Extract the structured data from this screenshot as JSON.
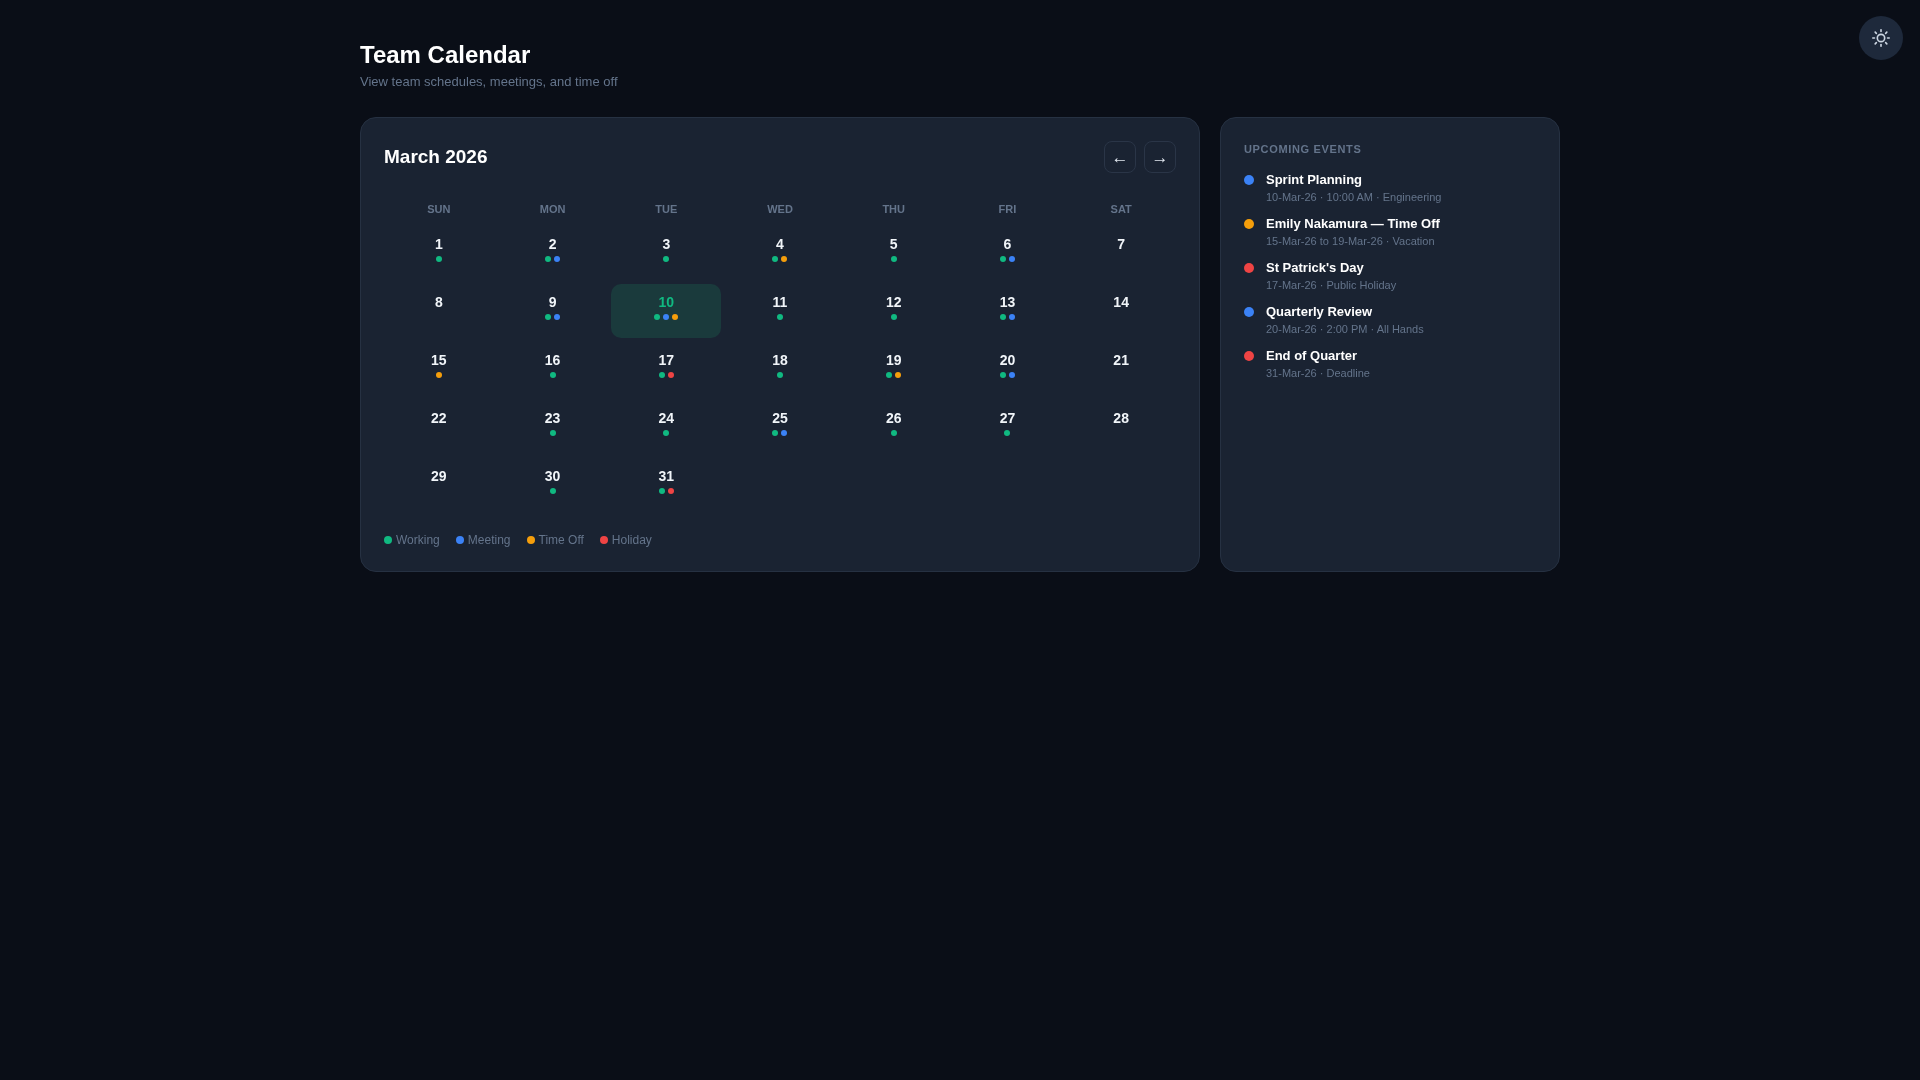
{
  "header": {
    "title": "Team Calendar",
    "subtitle": "View team schedules, meetings, and time off"
  },
  "calendar": {
    "month": "March 2026",
    "nav_buttons": [
      "←",
      "→"
    ],
    "weekdays": [
      "SUN",
      "MON",
      "TUE",
      "WED",
      "THU",
      "FRI",
      "SAT"
    ],
    "days": [
      {
        "label": "1",
        "selected": false,
        "dots": [
          {
            "color": "#10b981"
          }
        ]
      },
      {
        "label": "2",
        "selected": false,
        "dots": [
          {
            "color": "#10b981"
          },
          {
            "color": "#3b82f6"
          }
        ]
      },
      {
        "label": "3",
        "selected": false,
        "dots": [
          {
            "color": "#10b981"
          }
        ]
      },
      {
        "label": "4",
        "selected": false,
        "dots": [
          {
            "color": "#10b981"
          },
          {
            "color": "#f59e0b"
          }
        ]
      },
      {
        "label": "5",
        "selected": false,
        "dots": [
          {
            "color": "#10b981"
          }
        ]
      },
      {
        "label": "6",
        "selected": false,
        "dots": [
          {
            "color": "#10b981"
          },
          {
            "color": "#3b82f6"
          }
        ]
      },
      {
        "label": "7",
        "selected": false
      },
      {
        "label": "8",
        "selected": false
      },
      {
        "label": "9",
        "selected": false,
        "dots": [
          {
            "color": "#10b981"
          },
          {
            "color": "#3b82f6"
          }
        ]
      },
      {
        "label": "10",
        "selected": true,
        "dots": [
          {
            "color": "#10b981"
          },
          {
            "color": "#3b82f6"
          },
          {
            "color": "#f59e0b"
          }
        ]
      },
      {
        "label": "11",
        "selected": false,
        "dots": [
          {
            "color": "#10b981"
          }
        ]
      },
      {
        "label": "12",
        "selected": false,
        "dots": [
          {
            "color": "#10b981"
          }
        ]
      },
      {
        "label": "13",
        "selected": false,
        "dots": [
          {
            "color": "#10b981"
          },
          {
            "color": "#3b82f6"
          }
        ]
      },
      {
        "label": "14",
        "selected": false
      },
      {
        "label": "15",
        "selected": false,
        "dots": [
          {
            "color": "#f59e0b"
          }
        ]
      },
      {
        "label": "16",
        "selected": false,
        "dots": [
          {
            "color": "#10b981"
          }
        ]
      },
      {
        "label": "17",
        "selected": false,
        "dots": [
          {
            "color": "#10b981"
          },
          {
            "color": "#ef4444"
          }
        ]
      },
      {
        "label": "18",
        "selected": false,
        "dots": [
          {
            "color": "#10b981"
          }
        ]
      },
      {
        "label": "19",
        "selected": false,
        "dots": [
          {
            "color": "#10b981"
          },
          {
            "color": "#f59e0b"
          }
        ]
      },
      {
        "label": "20",
        "selected": false,
        "dots": [
          {
            "color": "#10b981"
          },
          {
            "color": "#3b82f6"
          }
        ]
      },
      {
        "label": "21",
        "selected": false
      },
      {
        "label": "22",
        "selected": false
      },
      {
        "label": "23",
        "selected": false,
        "dots": [
          {
            "color": "#10b981"
          }
        ]
      },
      {
        "label": "24",
        "selected": false,
        "dots": [
          {
            "color": "#10b981"
          }
        ]
      },
      {
        "label": "25",
        "selected": false,
        "dots": [
          {
            "color": "#10b981"
          },
          {
            "color": "#3b82f6"
          }
        ]
      },
      {
        "label": "26",
        "selected": false,
        "dots": [
          {
            "color": "#10b981"
          }
        ]
      },
      {
        "label": "27",
        "selected": false,
        "dots": [
          {
            "color": "#10b981"
          }
        ]
      },
      {
        "label": "28",
        "selected": false
      },
      {
        "label": "29",
        "selected": false
      },
      {
        "label": "30",
        "selected": false,
        "dots": [
          {
            "color": "#10b981"
          }
        ]
      },
      {
        "label": "31",
        "selected": false,
        "dots": [
          {
            "color": "#10b981"
          },
          {
            "color": "#ef4444"
          }
        ]
      }
    ],
    "legend": [
      {
        "label": "Working",
        "color": "#10b981"
      },
      {
        "label": "Meeting",
        "color": "#3b82f6"
      },
      {
        "label": "Time Off",
        "color": "#f59e0b"
      },
      {
        "label": "Holiday",
        "color": "#ef4444"
      }
    ]
  },
  "upcoming_events": {
    "title": "UPCOMING EVENTS",
    "events": [
      {
        "title": "Sprint Planning",
        "details": "10-Mar-26 · 10:00 AM · Engineering",
        "color": "#3b82f6"
      },
      {
        "title": "Emily Nakamura — Time Off",
        "details": "15-Mar-26 to 19-Mar-26 · Vacation",
        "color": "#f59e0b"
      },
      {
        "title": "St Patrick's Day",
        "details": "17-Mar-26 · Public Holiday",
        "color": "#ef4444"
      },
      {
        "title": "Quarterly Review",
        "details": "20-Mar-26 · 2:00 PM · All Hands",
        "color": "#3b82f6"
      },
      {
        "title": "End of Quarter",
        "details": "31-Mar-26 · Deadline",
        "color": "#ef4444"
      }
    ]
  }
}
